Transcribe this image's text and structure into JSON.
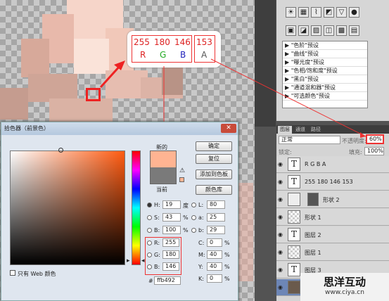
{
  "callout": {
    "r": "255",
    "g": "180",
    "b": "146",
    "a": "153",
    "r_label": "R",
    "g_label": "G",
    "b_label": "B",
    "a_label": "A"
  },
  "adjustments": {
    "icons": [
      "brightness-icon",
      "levels-icon",
      "curves-icon",
      "exposure-icon",
      "vibrance-icon",
      "hue-icon",
      "colorbalance-icon",
      "bw-icon",
      "photofilter-icon",
      "channelmixer-icon",
      "invert-icon",
      "posterize-icon",
      "threshold-icon",
      "gradientmap-icon",
      "selectivecolor-icon"
    ],
    "presets": [
      "\"色阶\"预设",
      "\"曲线\"预设",
      "\"曝光度\"预设",
      "\"色相/饱和度\"预设",
      "\"黑白\"预设",
      "\"通道混和器\"预设",
      "\"可选颜色\"预设"
    ]
  },
  "layers_panel": {
    "tabs": [
      "图层",
      "通道",
      "路径"
    ],
    "blend_mode": "正常",
    "opacity_label": "不透明度:",
    "opacity_value": "60%",
    "lock_label": "锁定:",
    "fill_label": "填充:",
    "fill_value": "100%",
    "layers": [
      {
        "name": "R  G  B  A",
        "thumb": "T"
      },
      {
        "name": "255 180 146 153",
        "thumb": "T"
      },
      {
        "name": "形状 2",
        "thumb": ""
      },
      {
        "name": "形状 1",
        "thumb": ""
      },
      {
        "name": "图层 2",
        "thumb": "T"
      },
      {
        "name": "图层 1",
        "thumb": ""
      },
      {
        "name": "图层 3",
        "thumb": "T"
      },
      {
        "name": "",
        "thumb": ""
      }
    ]
  },
  "color_picker": {
    "title": "拾色器（前景色）",
    "close": "✕",
    "new_label": "新的",
    "current_label": "当前",
    "ok": "确定",
    "reset": "复位",
    "add_swatch": "添加到色板",
    "libraries": "颜色库",
    "web_only": "只有 Web 颜色",
    "h": {
      "label": "H:",
      "value": "19",
      "unit": "度"
    },
    "s": {
      "label": "S:",
      "value": "43",
      "unit": "%"
    },
    "bv": {
      "label": "B:",
      "value": "100",
      "unit": "%"
    },
    "r": {
      "label": "R:",
      "value": "255"
    },
    "g": {
      "label": "G:",
      "value": "180"
    },
    "b": {
      "label": "B:",
      "value": "146"
    },
    "l": {
      "label": "L:",
      "value": "80"
    },
    "a": {
      "label": "a:",
      "value": "25"
    },
    "blab": {
      "label": "b:",
      "value": "29"
    },
    "c": {
      "label": "C:",
      "value": "0",
      "unit": "%"
    },
    "m": {
      "label": "M:",
      "value": "40",
      "unit": "%"
    },
    "y": {
      "label": "Y:",
      "value": "40",
      "unit": "%"
    },
    "k": {
      "label": "K:",
      "value": "0",
      "unit": "%"
    },
    "hex_label": "#",
    "hex": "ffb492",
    "new_color": "#ffb492",
    "current_color": "#7a7a7a"
  },
  "watermark": {
    "title": "思洋互动",
    "url": "www.ciya.cn"
  }
}
